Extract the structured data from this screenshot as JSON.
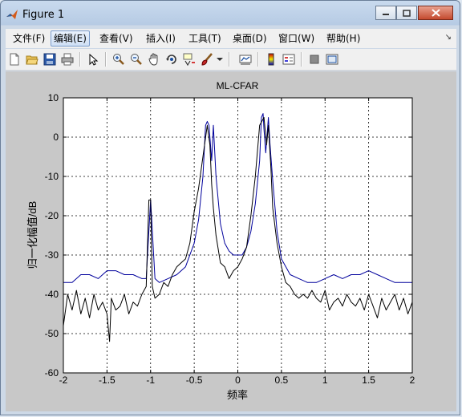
{
  "window": {
    "title": "Figure 1"
  },
  "menu": {
    "items": [
      {
        "label": "文件(F)"
      },
      {
        "label": "编辑(E)"
      },
      {
        "label": "查看(V)"
      },
      {
        "label": "插入(I)"
      },
      {
        "label": "工具(T)"
      },
      {
        "label": "桌面(D)"
      },
      {
        "label": "窗口(W)"
      },
      {
        "label": "帮助(H)"
      }
    ]
  },
  "toolbar": {
    "icons": [
      "new-figure-icon",
      "open-file-icon",
      "save-icon",
      "print-icon",
      "edit-plot-arrow-icon",
      "zoom-in-icon",
      "zoom-out-icon",
      "pan-hand-icon",
      "rotate-3d-icon",
      "data-cursor-icon",
      "brush-icon",
      "brush-dropdown-icon",
      "link-plot-icon",
      "colorbar-icon",
      "legend-icon",
      "hide-plot-tools-icon",
      "show-plot-tools-icon"
    ]
  },
  "chart_data": {
    "type": "line",
    "title": "ML-CFAR",
    "xlabel": "频率",
    "ylabel": "归一化幅值/dB",
    "xlim": [
      -2,
      2
    ],
    "ylim": [
      -60,
      10
    ],
    "xticks": [
      "-2",
      "-1.5",
      "-1",
      "-0.5",
      "0",
      "0.5",
      "1",
      "1.5",
      "2"
    ],
    "yticks": [
      "10",
      "0",
      "-10",
      "-20",
      "-30",
      "-40",
      "-50",
      "-60"
    ],
    "grid": "dashed",
    "series": [
      {
        "color": "#00009c",
        "x": [
          -2,
          -1.9,
          -1.8,
          -1.7,
          -1.6,
          -1.5,
          -1.4,
          -1.3,
          -1.2,
          -1.1,
          -1.05,
          -1.0,
          -0.95,
          -0.9,
          -0.8,
          -0.7,
          -0.6,
          -0.5,
          -0.45,
          -0.4,
          -0.37,
          -0.35,
          -0.33,
          -0.3,
          -0.28,
          -0.25,
          -0.2,
          -0.15,
          -0.1,
          -0.05,
          0,
          0.05,
          0.1,
          0.15,
          0.2,
          0.25,
          0.27,
          0.29,
          0.3,
          0.32,
          0.35,
          0.37,
          0.4,
          0.45,
          0.5,
          0.6,
          0.7,
          0.8,
          0.9,
          1.0,
          1.1,
          1.2,
          1.3,
          1.4,
          1.5,
          1.6,
          1.7,
          1.8,
          1.9,
          2.0
        ],
        "y": [
          -37,
          -37,
          -35,
          -35,
          -36,
          -34,
          -34,
          -35,
          -35,
          -36,
          -36,
          -16,
          -36,
          -37,
          -36,
          -35,
          -33,
          -27,
          -21,
          -10,
          3,
          4,
          3,
          -6,
          3,
          -10,
          -22,
          -27,
          -29,
          -30,
          -30,
          -30,
          -28,
          -24,
          -17,
          -6,
          5,
          6,
          2,
          -4,
          5,
          -2,
          -11,
          -24,
          -31,
          -35,
          -36,
          -37,
          -37,
          -36,
          -35,
          -36,
          -35,
          -35,
          -34,
          -35,
          -36,
          -37,
          -37,
          -37
        ]
      },
      {
        "color": "#000000",
        "x": [
          -2,
          -1.95,
          -1.9,
          -1.85,
          -1.8,
          -1.75,
          -1.7,
          -1.65,
          -1.6,
          -1.55,
          -1.5,
          -1.47,
          -1.45,
          -1.4,
          -1.35,
          -1.3,
          -1.25,
          -1.2,
          -1.15,
          -1.1,
          -1.05,
          -1.02,
          -1.0,
          -0.98,
          -0.95,
          -0.9,
          -0.85,
          -0.8,
          -0.75,
          -0.7,
          -0.65,
          -0.6,
          -0.55,
          -0.5,
          -0.45,
          -0.4,
          -0.35,
          -0.32,
          -0.3,
          -0.28,
          -0.25,
          -0.2,
          -0.15,
          -0.1,
          -0.05,
          0,
          0.05,
          0.1,
          0.15,
          0.2,
          0.25,
          0.3,
          0.33,
          0.35,
          0.38,
          0.4,
          0.45,
          0.5,
          0.55,
          0.6,
          0.65,
          0.7,
          0.75,
          0.8,
          0.85,
          0.9,
          0.95,
          1.0,
          1.05,
          1.1,
          1.15,
          1.2,
          1.25,
          1.3,
          1.35,
          1.4,
          1.45,
          1.5,
          1.55,
          1.6,
          1.65,
          1.7,
          1.75,
          1.8,
          1.85,
          1.9,
          1.95,
          2.0
        ],
        "y": [
          -48,
          -40,
          -44,
          -39,
          -45,
          -41,
          -46,
          -40,
          -44,
          -42,
          -45,
          -52,
          -41,
          -44,
          -43,
          -40,
          -45,
          -42,
          -43,
          -40,
          -38,
          -16,
          -16,
          -38,
          -41,
          -40,
          -37,
          -38,
          -35,
          -33,
          -32,
          -31,
          -27,
          -19,
          -13,
          -5,
          3,
          -2,
          -12,
          -18,
          -25,
          -32,
          -33,
          -36,
          -34,
          -33,
          -31,
          -28,
          -20,
          -10,
          3,
          5,
          -2,
          3,
          -8,
          -18,
          -27,
          -33,
          -37,
          -38,
          -40,
          -41,
          -40,
          -41,
          -39,
          -41,
          -42,
          -39,
          -44,
          -42,
          -41,
          -43,
          -40,
          -42,
          -43,
          -41,
          -44,
          -40,
          -43,
          -46,
          -41,
          -44,
          -42,
          -40,
          -44,
          -41,
          -45,
          -42
        ]
      }
    ]
  }
}
